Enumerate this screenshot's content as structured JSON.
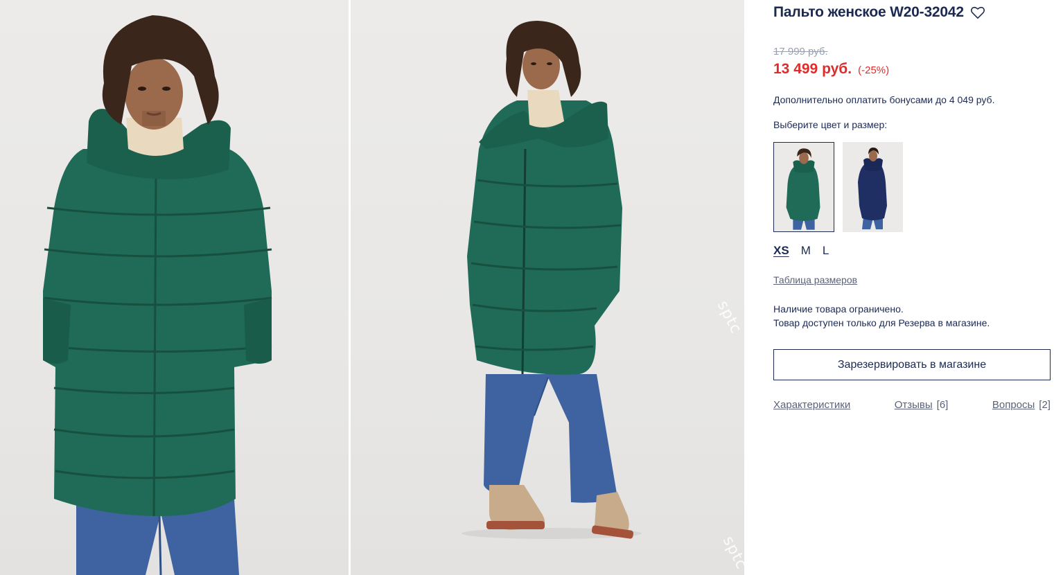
{
  "product": {
    "title": "Пальто женское W20-32042",
    "old_price": "17 999 руб.",
    "price": "13 499 руб.",
    "discount": "(-25%)",
    "bonus_text": "Дополнительно оплатить бонусами до 4 049 руб.",
    "choose_label": "Выберите цвет и размер:"
  },
  "colors": [
    {
      "name": "green",
      "hex": "#1f6b57",
      "selected": true
    },
    {
      "name": "navy",
      "hex": "#1f2f63",
      "selected": false
    }
  ],
  "sizes": [
    {
      "label": "XS",
      "selected": true
    },
    {
      "label": "M",
      "selected": false
    },
    {
      "label": "L",
      "selected": false
    }
  ],
  "size_table_link": "Таблица размеров",
  "stock": {
    "line1": "Наличие товара ограничено.",
    "line2": "Товар доступен только для Резерва в магазине."
  },
  "reserve_button": "Зарезервировать в магазине",
  "tabs": [
    {
      "label": "Характеристики",
      "count": ""
    },
    {
      "label": "Отзывы",
      "count": "[6]"
    },
    {
      "label": "Вопросы",
      "count": "[2]"
    }
  ],
  "watermark": "sptc",
  "theme": {
    "text": "#1c2951",
    "price_red": "#e02b2b",
    "coat_green": "#1f6b57",
    "coat_navy": "#1f2f63",
    "jeans": "#3e63a0"
  }
}
